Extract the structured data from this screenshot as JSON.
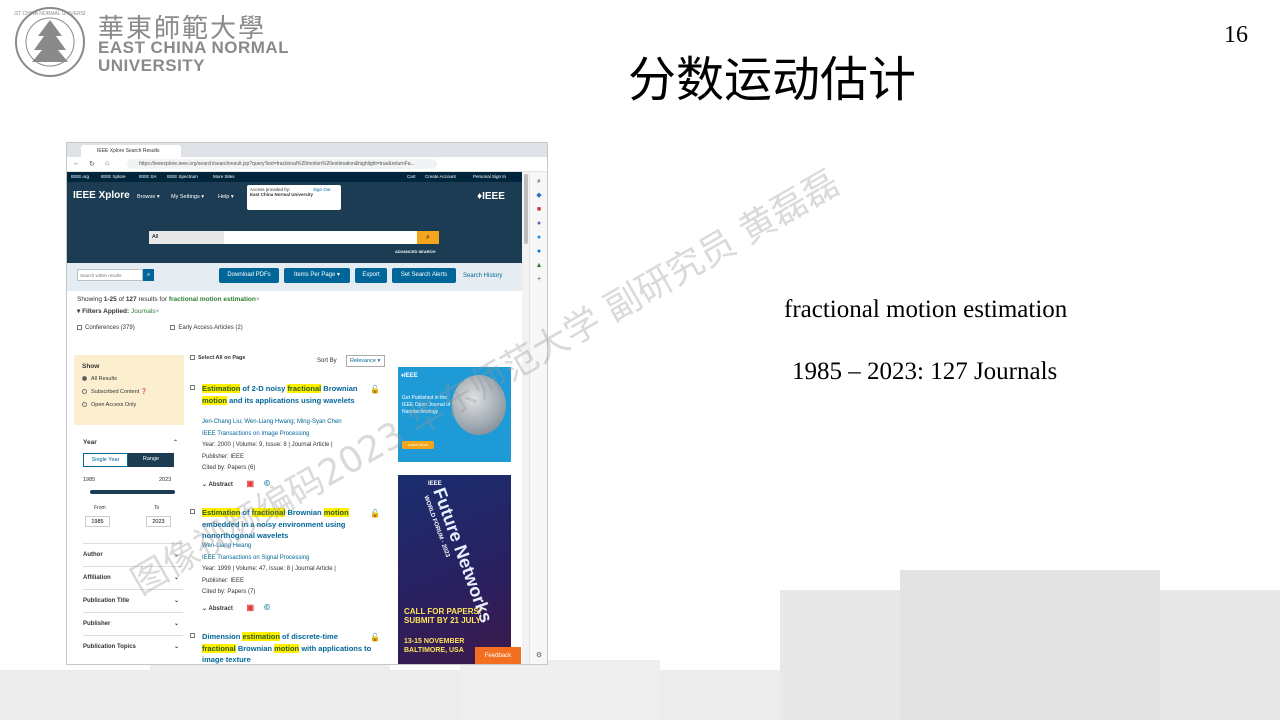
{
  "slide": {
    "uni_cn": "華東師範大學",
    "uni_en_line1": "EAST CHINA NORMAL",
    "uni_en_line2": "UNIVERSITY",
    "title": "分数运动估计",
    "page_number": "16",
    "query_text": "fractional motion estimation",
    "range_text": "1985 – 2023: 127 Journals",
    "watermark": "图像视频编码2023 华东师范大学 副研究员 黄磊磊"
  },
  "browser": {
    "tab_title": "IEEE Xplore Search Results",
    "url": "https://ieeexplore.ieee.org/search/searchresult.jsp?queryText=fractional%20motion%20estimation&highlight=true&returnFa..."
  },
  "ieee": {
    "top_links": [
      "IEEE.org",
      "IEEE Xplore",
      "IEEE SA",
      "IEEE Spectrum",
      "More Sites"
    ],
    "top_right": [
      "Cart",
      "Create Account",
      "Personal Sign In"
    ],
    "logo": "IEEE Xplore",
    "brand": "♦IEEE",
    "menu": [
      "Browse ▾",
      "My Settings ▾",
      "Help ▾"
    ],
    "access_label": "Access provided by:",
    "access_org": "East China Normal University",
    "sign_out": "Sign Out",
    "search_scope": "All",
    "advanced": "ADVANCED SEARCH",
    "search_within_placeholder": "Search within results",
    "toolbar": [
      "Download PDFs",
      "Items Per Page ▾",
      "Export",
      "Set Search Alerts"
    ],
    "search_history": "Search History",
    "showing_prefix": "Showing ",
    "showing_range": "1-25",
    "showing_of": " of ",
    "showing_total": "127",
    "showing_suffix": " results for ",
    "query": "fractional motion estimation",
    "filters_label": "▾ Filters Applied:",
    "filter_value": "Journals",
    "facet_conferences": "Conferences (379)",
    "facet_early": "Early Access Articles (2)"
  },
  "left_panel": {
    "show_title": "Show",
    "show_options": [
      "All Results",
      "Subscribed Content",
      "Open Access Only"
    ],
    "year_title": "Year",
    "single_year": "Single Year",
    "range": "Range",
    "year_min": "1985",
    "year_max": "2023",
    "from_label": "From",
    "to_label": "To",
    "from_value": "1985",
    "to_value": "2023",
    "facets": [
      "Author",
      "Affiliation",
      "Publication Title",
      "Publisher",
      "Publication Topics"
    ]
  },
  "results": {
    "select_all": "Select All on Page",
    "sort_by": "Sort By",
    "sort_value": "Relevance ▾",
    "items": [
      {
        "title_parts": [
          {
            "t": "Estimation",
            "hl": true
          },
          {
            "t": " of 2-D noisy ",
            "hl": false
          },
          {
            "t": "fractional",
            "hl": true
          },
          {
            "t": " Brownian ",
            "hl": false
          },
          {
            "t": "motion",
            "hl": true
          },
          {
            "t": " and its applications using wavelets",
            "hl": false
          }
        ],
        "authors": "Jen-Chang Liu; Wen-Liang Hwang; Ming-Syan Chen",
        "pub": "IEEE Transactions on Image Processing",
        "meta": "Year: 2000 | Volume: 9, Issue: 8 | Journal Article |",
        "publisher": "Publisher: IEEE",
        "cited": "Cited by: Papers (6)"
      },
      {
        "title_parts": [
          {
            "t": "Estimation",
            "hl": true
          },
          {
            "t": " of ",
            "hl": false
          },
          {
            "t": "fractional",
            "hl": true
          },
          {
            "t": " Brownian ",
            "hl": false
          },
          {
            "t": "motion",
            "hl": true
          },
          {
            "t": " embedded in a noisy environment using nonorthogonal wavelets",
            "hl": false
          }
        ],
        "authors": "Wen-Liang Hwang",
        "pub": "IEEE Transactions on Signal Processing",
        "meta": "Year: 1999 | Volume: 47, Issue: 8 | Journal Article |",
        "publisher": "Publisher: IEEE",
        "cited": "Cited by: Papers (7)"
      },
      {
        "title_parts": [
          {
            "t": "Dimension ",
            "hl": false
          },
          {
            "t": "estimation",
            "hl": true
          },
          {
            "t": " of discrete-time ",
            "hl": false
          },
          {
            "t": "fractional",
            "hl": true
          },
          {
            "t": " Brownian ",
            "hl": false
          },
          {
            "t": "motion",
            "hl": true
          },
          {
            "t": " with applications to image texture",
            "hl": false
          }
        ]
      }
    ],
    "abstract_label": "Abstract"
  },
  "ads": {
    "ad1_logo": "♦IEEE",
    "ad1_text": "Get Published in the IEEE Open Journal of Nanotechnology",
    "ad1_button": "Learn More",
    "ad2_brand": "IEEE",
    "ad2_title": "Future Networks",
    "ad2_sub": "WORLD FORUM · 2023",
    "ad2_cfp1": "CALL FOR PAPERS!",
    "ad2_cfp2": "SUBMIT BY 21 JULY",
    "ad2_date1": "13-15 NOVEMBER",
    "ad2_date2": "BALTIMORE, USA"
  },
  "feedback": "Feedback"
}
